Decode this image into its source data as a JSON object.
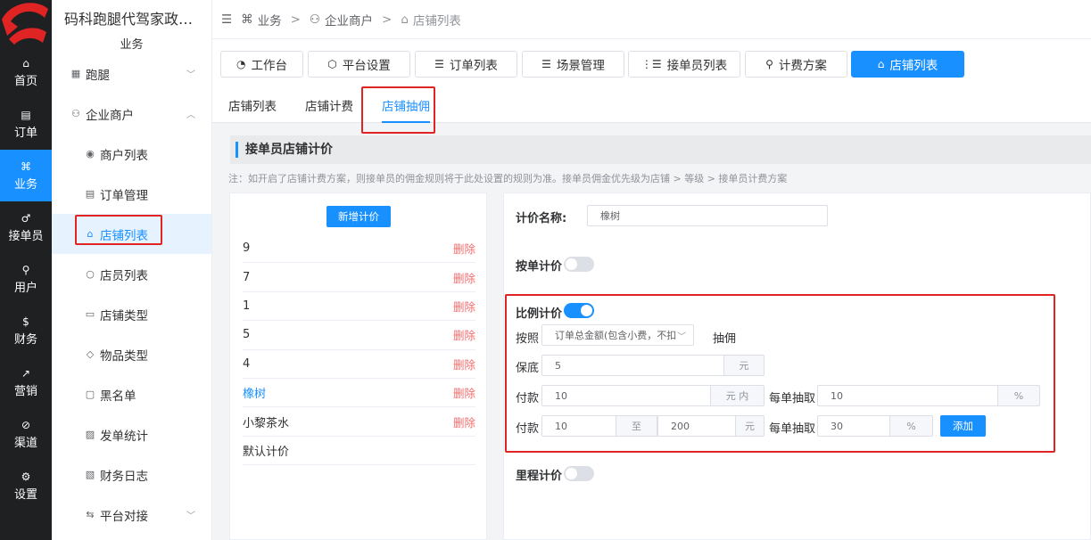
{
  "rail": {
    "items": [
      {
        "icon": "⌂",
        "label": "首页"
      },
      {
        "icon": "▤",
        "label": "订单"
      },
      {
        "icon": "⌘",
        "label": "业务"
      },
      {
        "icon": "♂",
        "label": "接单员"
      },
      {
        "icon": "⚲",
        "label": "用户"
      },
      {
        "icon": "$",
        "label": "财务"
      },
      {
        "icon": "↗",
        "label": "营销"
      },
      {
        "icon": "⊘",
        "label": "渠道"
      },
      {
        "icon": "⚙",
        "label": "设置"
      }
    ]
  },
  "sidebar": {
    "brand": "码科跑腿代驾家政…",
    "section": "业务",
    "items": [
      {
        "label": "跑腿"
      },
      {
        "label": "企业商户"
      },
      {
        "label": "商户列表"
      },
      {
        "label": "订单管理"
      },
      {
        "label": "店铺列表"
      },
      {
        "label": "店员列表"
      },
      {
        "label": "店铺类型"
      },
      {
        "label": "物品类型"
      },
      {
        "label": "黑名单"
      },
      {
        "label": "发单统计"
      },
      {
        "label": "财务日志"
      },
      {
        "label": "平台对接"
      }
    ]
  },
  "breadcrumb": {
    "c1": "业务",
    "c2": "企业商户",
    "c3": "店铺列表"
  },
  "tabs": [
    {
      "label": "工作台"
    },
    {
      "label": "平台设置"
    },
    {
      "label": "订单列表"
    },
    {
      "label": "场景管理"
    },
    {
      "label": "接单员列表"
    },
    {
      "label": "计费方案"
    },
    {
      "label": "店铺列表"
    }
  ],
  "subtabs": [
    {
      "label": "店铺列表"
    },
    {
      "label": "店铺计费"
    },
    {
      "label": "店铺抽佣"
    }
  ],
  "section_title": "接单员店铺计价",
  "note": "注：如开启了店铺计费方案，则接单员的佣金规则将于此处设置的规则为准。接单员佣金优先级为店铺 > 等级 > 接单员计费方案",
  "list": {
    "add_label": "新增计价",
    "delete_label": "删除",
    "items": [
      {
        "name": "9"
      },
      {
        "name": "7"
      },
      {
        "name": "1"
      },
      {
        "name": "5"
      },
      {
        "name": "4"
      },
      {
        "name": "橡树"
      },
      {
        "name": "小黎茶水"
      },
      {
        "name": "默认计价"
      }
    ]
  },
  "detail": {
    "name_label": "计价名称:",
    "name_value": "橡树",
    "per_order_label": "按单计价",
    "ratio_label": "比例计价",
    "basis_label": "按照",
    "basis_value": "订单总金额(包含小费，不扣",
    "commission_label": "抽佣",
    "min_label": "保底",
    "min_value": "5",
    "yuan": "元",
    "pay_label": "付款",
    "pay_value": "10",
    "within_label": "元 内",
    "each_label": "每单抽取",
    "each_value_1": "10",
    "percent": "%",
    "range_from": "10",
    "to_label": "至",
    "range_to": "200",
    "each_value_2": "30",
    "add_label": "添加",
    "distance_label": "里程计价"
  },
  "colors": {
    "accent": "#1890ff",
    "highlight": "#e02424",
    "rail": "#1f2022"
  }
}
